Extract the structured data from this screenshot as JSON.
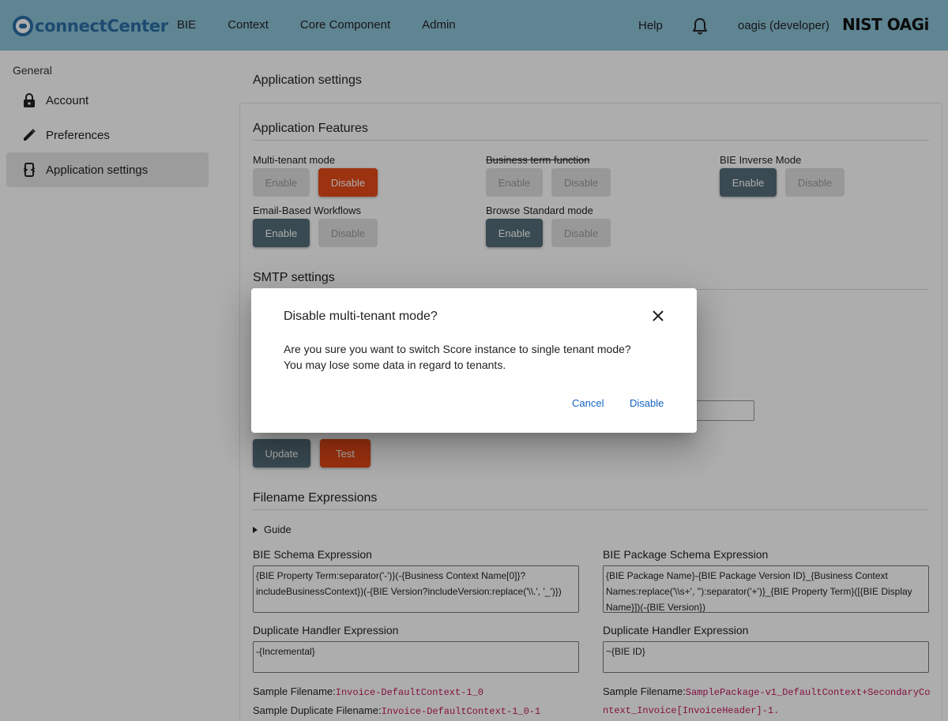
{
  "header": {
    "logo_text": "connectCenter",
    "nav": [
      "BIE",
      "Context",
      "Core Component",
      "Admin"
    ],
    "help_label": "Help",
    "user_label": "oagis (developer)",
    "partner_logo": "NIST OAGi"
  },
  "sidebar": {
    "heading": "General",
    "items": [
      {
        "label": "Account",
        "icon": "lock-icon"
      },
      {
        "label": "Preferences",
        "icon": "pencil-icon"
      },
      {
        "label": "Application settings",
        "icon": "settings-phone-icon"
      }
    ]
  },
  "main": {
    "page_title": "Application settings",
    "features": {
      "title": "Application Features",
      "items": [
        {
          "label": "Multi-tenant mode",
          "enable": "Enable",
          "disable": "Disable",
          "state": "enabled"
        },
        {
          "label": "Business term function",
          "enable": "Enable",
          "disable": "Disable",
          "state": "unavailable"
        },
        {
          "label": "BIE Inverse Mode",
          "enable": "Enable",
          "disable": "Disable",
          "state": "disabled"
        },
        {
          "label": "Email-Based Workflows",
          "enable": "Enable",
          "disable": "Disable",
          "state": "disabled"
        },
        {
          "label": "Browse Standard mode",
          "enable": "Enable",
          "disable": "Disable",
          "state": "disabled"
        }
      ]
    },
    "smtp": {
      "title": "SMTP settings",
      "update_label": "Update",
      "test_label": "Test"
    },
    "filename": {
      "title": "Filename Expressions",
      "guide_label": "Guide",
      "bie_schema_label": "BIE Schema Expression",
      "bie_schema_value": "{BIE Property Term:separator('-')}(-{Business Context Name[0]}?includeBusinessContext})(-{BIE Version?includeVersion:replace('\\\\.', '_')})",
      "bie_dup_label": "Duplicate Handler Expression",
      "bie_dup_value": "-{Incremental}",
      "bie_sample_label": "Sample Filename:",
      "bie_sample_value": "Invoice-DefaultContext-1_0",
      "bie_sample_dup_label": "Sample Duplicate Filename:",
      "bie_sample_dup_value": "Invoice-DefaultContext-1_0-1",
      "pkg_schema_label": "BIE Package Schema Expression",
      "pkg_schema_value": "{BIE Package Name}-{BIE Package Version ID}_{Business Context Names:replace('\\\\s+', ''):separator('+')}_{BIE Property Term}([{BIE Display Name}])(-{BIE Version})",
      "pkg_dup_label": "Duplicate Handler Expression",
      "pkg_dup_value": "~{BIE ID}",
      "pkg_sample_label": "Sample Filename:",
      "pkg_sample_value": "SamplePackage-v1_DefaultContext+SecondaryContext_Invoice[InvoiceHeader]-1."
    }
  },
  "dialog": {
    "title": "Disable multi-tenant mode?",
    "body_line1": "Are you sure you want to switch Score instance to single tenant mode?",
    "body_line2": "You may lose some data in regard to tenants.",
    "cancel_label": "Cancel",
    "confirm_label": "Disable"
  },
  "colors": {
    "header_bg": "#8cc3d8",
    "brand_blue": "#2a6ea6",
    "slate_button": "#546e7a",
    "orange_button": "#e64a19",
    "link_blue": "#1565c0",
    "sample_magenta": "#c2185b"
  }
}
